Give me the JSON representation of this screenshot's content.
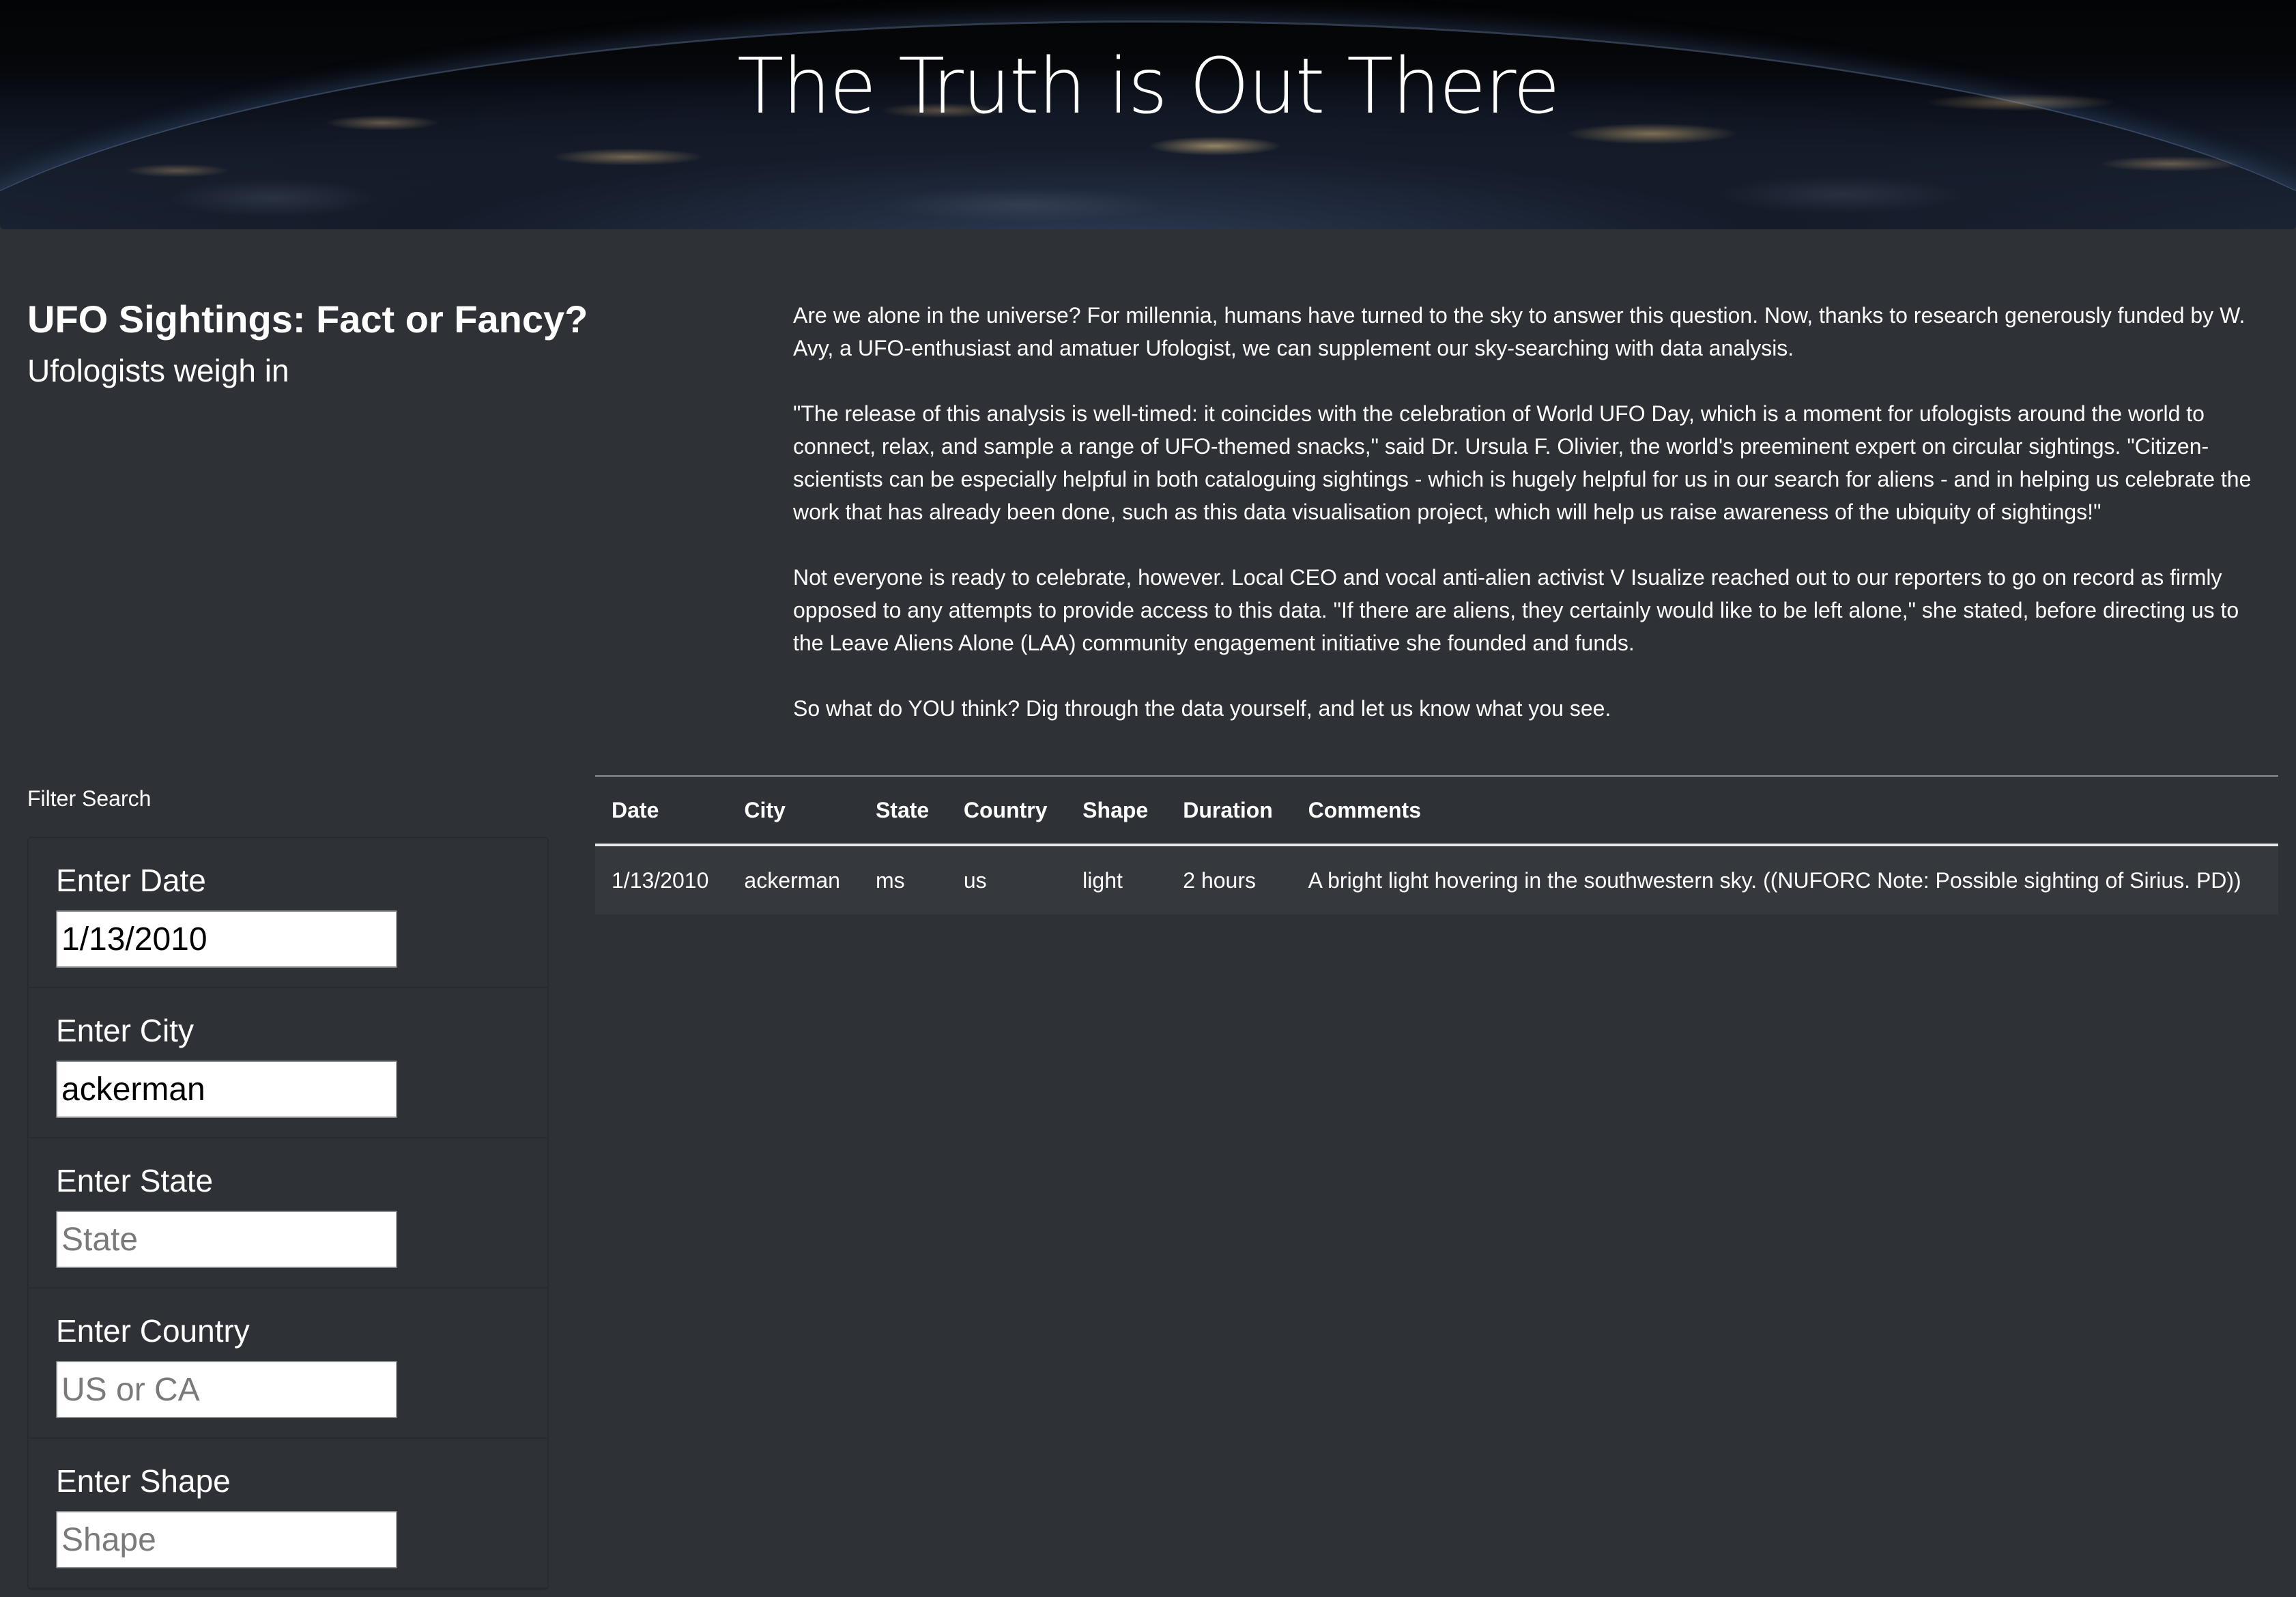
{
  "header": {
    "title": "The Truth is Out There"
  },
  "intro": {
    "title": "UFO Sightings: Fact or Fancy?",
    "subtitle": "Ufologists weigh in",
    "paragraphs": [
      "Are we alone in the universe? For millennia, humans have turned to the sky to answer this question. Now, thanks to research generously funded by W. Avy, a UFO-enthusiast and amatuer Ufologist, we can supplement our sky-searching with data analysis.",
      "\"The release of this analysis is well-timed: it coincides with the celebration of World UFO Day, which is a moment for ufologists around the world to connect, relax, and sample a range of UFO-themed snacks,\" said Dr. Ursula F. Olivier, the world's preeminent expert on circular sightings. \"Citizen-scientists can be especially helpful in both cataloguing sightings - which is hugely helpful for us in our search for aliens - and in helping us celebrate the work that has already been done, such as this data visualisation project, which will help us raise awareness of the ubiquity of sightings!\"",
      "Not everyone is ready to celebrate, however. Local CEO and vocal anti-alien activist V Isualize reached out to our reporters to go on record as firmly opposed to any attempts to provide access to this data. \"If there are aliens, they certainly would like to be left alone,\" she stated, before directing us to the Leave Aliens Alone (LAA) community engagement initiative she founded and funds.",
      "So what do YOU think? Dig through the data yourself, and let us know what you see."
    ]
  },
  "filters": {
    "heading": "Filter Search",
    "items": [
      {
        "label": "Enter Date",
        "value": "1/13/2010",
        "placeholder": ""
      },
      {
        "label": "Enter City",
        "value": "ackerman",
        "placeholder": ""
      },
      {
        "label": "Enter State",
        "value": "",
        "placeholder": "State"
      },
      {
        "label": "Enter Country",
        "value": "",
        "placeholder": "US or CA"
      },
      {
        "label": "Enter Shape",
        "value": "",
        "placeholder": "Shape"
      }
    ]
  },
  "table": {
    "columns": [
      "Date",
      "City",
      "State",
      "Country",
      "Shape",
      "Duration",
      "Comments"
    ],
    "rows": [
      [
        "1/13/2010",
        "ackerman",
        "ms",
        "us",
        "light",
        "2 hours",
        "A bright light hovering in the southwestern sky. ((NUFORC Note: Possible sighting of Sirius. PD))"
      ]
    ]
  }
}
